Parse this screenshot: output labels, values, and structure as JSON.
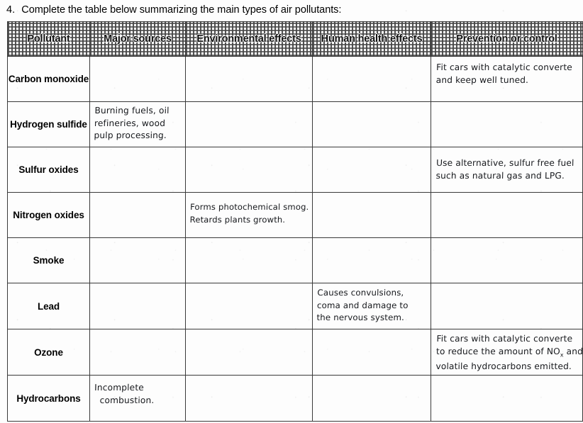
{
  "question": {
    "number": "4.",
    "text": "Complete the table below summarizing the main types of air pollutants:"
  },
  "table": {
    "headers": [
      "Pollutant",
      "Major sources",
      "Environmental effects",
      "Human health effects",
      "Prevention or control"
    ],
    "rows": [
      {
        "pollutant": "Carbon monoxide",
        "pollutant_lines": [
          "Carbon",
          "monoxide"
        ],
        "major_sources": "",
        "environmental_effects": "",
        "human_health_effects": "",
        "prevention_or_control": "Fit cars with catalytic converters and keep well tuned.",
        "prevention_lines": [
          "Fit cars with catalytic converte",
          "and keep well tuned."
        ]
      },
      {
        "pollutant": "Hydrogen sulfide",
        "pollutant_lines": [
          "Hydrogen",
          "sulfide"
        ],
        "major_sources": "Burning fuels, oil refineries, wood pulp processing.",
        "major_sources_lines": [
          "Burning fuels, oil",
          "refineries, wood",
          "pulp processing."
        ],
        "environmental_effects": "",
        "human_health_effects": "",
        "prevention_or_control": ""
      },
      {
        "pollutant": "Sulfur oxides",
        "pollutant_lines": [
          "Sulfur",
          "oxides"
        ],
        "major_sources": "",
        "environmental_effects": "",
        "human_health_effects": "",
        "prevention_or_control": "Use alternative, sulfur free fuels such as natural gas and LPG.",
        "prevention_lines": [
          "Use alternative, sulfur free fuel",
          "such as natural gas and LPG."
        ]
      },
      {
        "pollutant": "Nitrogen oxides",
        "pollutant_lines": [
          "Nitrogen",
          "oxides"
        ],
        "major_sources": "",
        "environmental_effects": "Forms photochemical smog. Retards plants growth.",
        "environmental_lines": [
          "Forms photochemical smog.",
          "Retards plants growth."
        ],
        "human_health_effects": "",
        "prevention_or_control": ""
      },
      {
        "pollutant": "Smoke",
        "pollutant_lines": [
          "Smoke"
        ],
        "major_sources": "",
        "environmental_effects": "",
        "human_health_effects": "",
        "prevention_or_control": ""
      },
      {
        "pollutant": "Lead",
        "pollutant_lines": [
          "Lead"
        ],
        "major_sources": "",
        "environmental_effects": "",
        "human_health_effects": "Causes convulsions, coma and damage to the nervous system.",
        "health_lines": [
          "Causes convulsions,",
          "coma and damage to",
          "the nervous system."
        ],
        "prevention_or_control": ""
      },
      {
        "pollutant": "Ozone",
        "pollutant_lines": [
          "Ozone"
        ],
        "major_sources": "",
        "environmental_effects": "",
        "human_health_effects": "",
        "prevention_or_control": "Fit cars with catalytic converters to reduce the amount of NOx and volatile hydrocarbons emitted.",
        "prevention_lines": [
          "Fit cars with catalytic converte",
          "to reduce the amount of NO",
          "volatile hydrocarbons emitted."
        ],
        "prevention_line2_tail": " and"
      },
      {
        "pollutant": "Hydrocarbons",
        "pollutant_lines": [
          "Hydrocarbons"
        ],
        "major_sources": "Incomplete combustion.",
        "major_sources_lines": [
          "Incomplete",
          "combustion."
        ],
        "environmental_effects": "",
        "human_health_effects": "",
        "prevention_or_control": ""
      }
    ]
  },
  "colors": {
    "ink": "#16181c",
    "print": "#111111",
    "rule": "#3a3a3a",
    "header_fill": "#464646",
    "paper": "#fdfdfd"
  }
}
